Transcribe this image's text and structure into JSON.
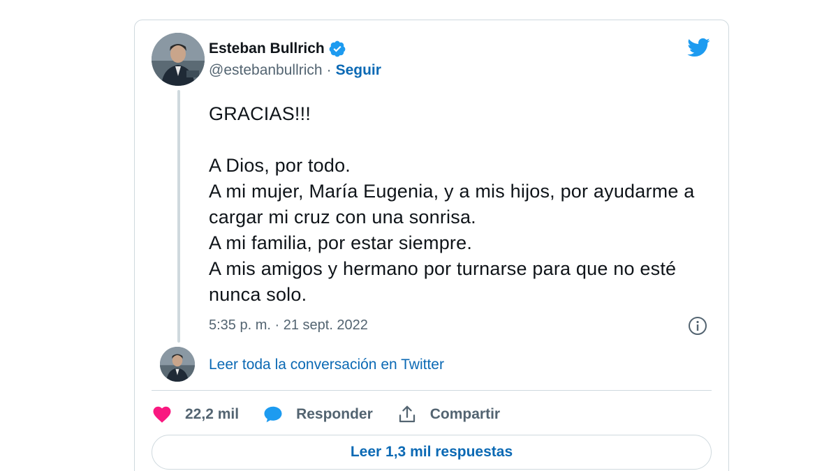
{
  "author": {
    "name": "Esteban Bullrich",
    "handle": "@estebanbullrich",
    "separator": "·",
    "follow_label": "Seguir"
  },
  "tweet": {
    "text": "GRACIAS!!!\n\nA Dios, por todo.\nA mi mujer, María Eugenia, y a mis hijos, por ayudarme a cargar mi cruz con una sonrisa.\nA mi familia, por estar siempre.\nA mis amigos y hermano por turnarse para que no esté nunca solo.",
    "timestamp": "5:35 p. m. · 21 sept. 2022"
  },
  "conversation": {
    "link_label": "Leer toda la conversación en Twitter"
  },
  "actions": {
    "likes": "22,2 mil",
    "reply_label": "Responder",
    "share_label": "Compartir"
  },
  "replies": {
    "label": "Leer 1,3 mil respuestas"
  },
  "icons": {
    "logo": "twitter-bird-icon",
    "verified": "verified-badge-icon",
    "info": "info-icon",
    "like": "heart-icon",
    "reply": "speech-bubble-icon",
    "share": "share-icon"
  },
  "colors": {
    "accent": "#1d9bf0",
    "link": "#0b69b4",
    "like": "#f91880",
    "text": "#0f1419",
    "muted": "#536471",
    "border": "#cfd9de"
  }
}
